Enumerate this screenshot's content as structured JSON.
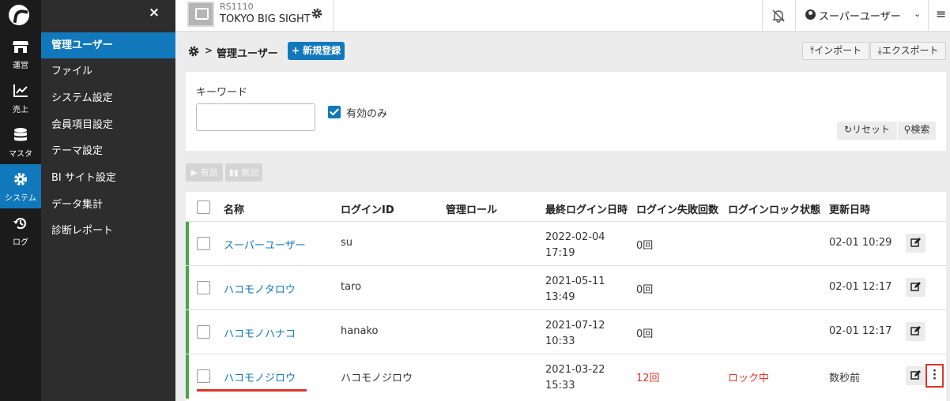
{
  "rail": {
    "items": [
      {
        "label": "運営",
        "icon": "store-icon"
      },
      {
        "label": "売上",
        "icon": "chart-line-icon"
      },
      {
        "label": "マスタ",
        "icon": "database-icon"
      },
      {
        "label": "システム",
        "icon": "gear-icon",
        "active": true
      },
      {
        "label": "ログ",
        "icon": "history-icon"
      }
    ]
  },
  "menu": {
    "close": "×",
    "items": [
      "管理ユーザー",
      "ファイル",
      "システム設定",
      "会員項目設定",
      "テーマ設定",
      "BI サイト設定",
      "データ集計",
      "診断レポート"
    ]
  },
  "topbar": {
    "store_code": "RS1110",
    "store_name": "TOKYO BIG SIGHT",
    "user_name": "スーパーユーザー"
  },
  "page": {
    "breadcrumb_sep": ">",
    "title": "管理ユーザー",
    "new_button": "+ 新規登録",
    "import_button": "インポート",
    "export_button": "エクスポート"
  },
  "search": {
    "keyword_label": "キーワード",
    "keyword_value": "",
    "active_only_label": "有効のみ",
    "active_only_checked": true,
    "reset_button": "リセット",
    "search_button": "検索"
  },
  "bulk": {
    "enable_button": "▶ 有効",
    "disable_button": "▮▮ 無効"
  },
  "table": {
    "headers": [
      "名称",
      "ログインID",
      "管理ロール",
      "最終ログイン日時",
      "ログイン失敗回数",
      "ログインロック状態",
      "更新日時"
    ],
    "rows": [
      {
        "name": "スーパーユーザー",
        "login_id": "su",
        "role": "",
        "last_date": "2022-02-04",
        "last_time": "17:19",
        "fail": "0回",
        "lock": "",
        "updated": "02-01 10:29"
      },
      {
        "name": "ハコモノタロウ",
        "login_id": "taro",
        "role": "",
        "last_date": "2021-05-11",
        "last_time": "13:49",
        "fail": "0回",
        "lock": "",
        "updated": "02-01 12:17"
      },
      {
        "name": "ハコモノハナコ",
        "login_id": "hanako",
        "role": "",
        "last_date": "2021-07-12",
        "last_time": "10:33",
        "fail": "0回",
        "lock": "",
        "updated": "02-01 12:17"
      },
      {
        "name": "ハコモノジロウ",
        "login_id": "ハコモノジロウ",
        "role": "",
        "last_date": "2021-03-22",
        "last_time": "15:33",
        "fail": "12回",
        "lock": "ロック中",
        "updated": "数秒前"
      }
    ]
  },
  "colors": {
    "accent": "#1178bb",
    "active_bar": "#4aa54b",
    "alert": "#e0342b"
  }
}
